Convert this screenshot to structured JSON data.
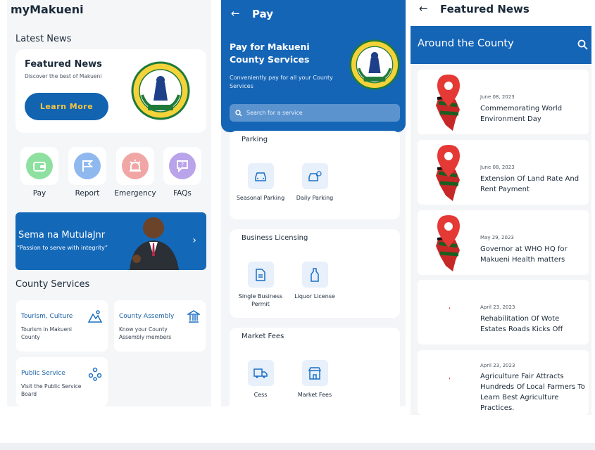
{
  "panel_home": {
    "app_title": "myMakueni",
    "latest_news_heading": "Latest News",
    "featured": {
      "title": "Featured News",
      "subtitle": "Discover the best of Makueni",
      "button": "Learn More"
    },
    "quick_actions": [
      {
        "label": "Pay",
        "icon": "wallet-icon",
        "color": "#8ee0a0"
      },
      {
        "label": "Report",
        "icon": "flag-icon",
        "color": "#8fb8ef"
      },
      {
        "label": "Emergency",
        "icon": "alarm-icon",
        "color": "#f1a6a6"
      },
      {
        "label": "FAQs",
        "icon": "chat-question-icon",
        "color": "#b9a3ea"
      }
    ],
    "banner": {
      "title": "Sema na MutulaJnr",
      "subtitle": "“Passion to serve with integrity”",
      "chevron": "›"
    },
    "county_services_heading": "County Services",
    "services": [
      {
        "title": "Tourism, Culture",
        "subtitle": "Tourism in Makueni County",
        "icon": "mountain-icon"
      },
      {
        "title": "County Assembly",
        "subtitle": "Know your County Assembly members",
        "icon": "building-icon"
      },
      {
        "title": "Public Service",
        "subtitle": "Visit the Public Service Board",
        "icon": "people-icon"
      }
    ]
  },
  "panel_pay": {
    "title": "Pay",
    "headline": "Pay for Makueni County Services",
    "description": "Conveniently pay for all your County Services",
    "search_placeholder": "Search for a service",
    "sections": [
      {
        "heading": "Parking",
        "tiles": [
          "Seasonal Parking",
          "Daily Parking"
        ]
      },
      {
        "heading": "Business Licensing",
        "tiles": [
          "Single Business Permit",
          "Liquor License"
        ]
      },
      {
        "heading": "Market Fees",
        "tiles": [
          "Cess",
          "Market Fees"
        ]
      }
    ]
  },
  "panel_news": {
    "title": "Featured News",
    "bar_title": "Around the County",
    "items": [
      {
        "date": "June 08, 2023",
        "title": "Commemorating World Environment Day"
      },
      {
        "date": "June 08, 2023",
        "title": "Extension Of Land Rate And Rent Payment"
      },
      {
        "date": "May 29, 2023",
        "title": "Governor at WHO HQ for Makueni Health matters"
      },
      {
        "date": "April 23, 2023",
        "title": "Rehabilitation Of Wote Estates Roads Kicks Off"
      },
      {
        "date": "April 23, 2023",
        "title": "Agriculture Fair Attracts Hundreds Of Local Farmers To Learn Best Agriculture Practices."
      }
    ]
  },
  "colors": {
    "primary": "#1565b6",
    "accent": "#f4c542"
  }
}
